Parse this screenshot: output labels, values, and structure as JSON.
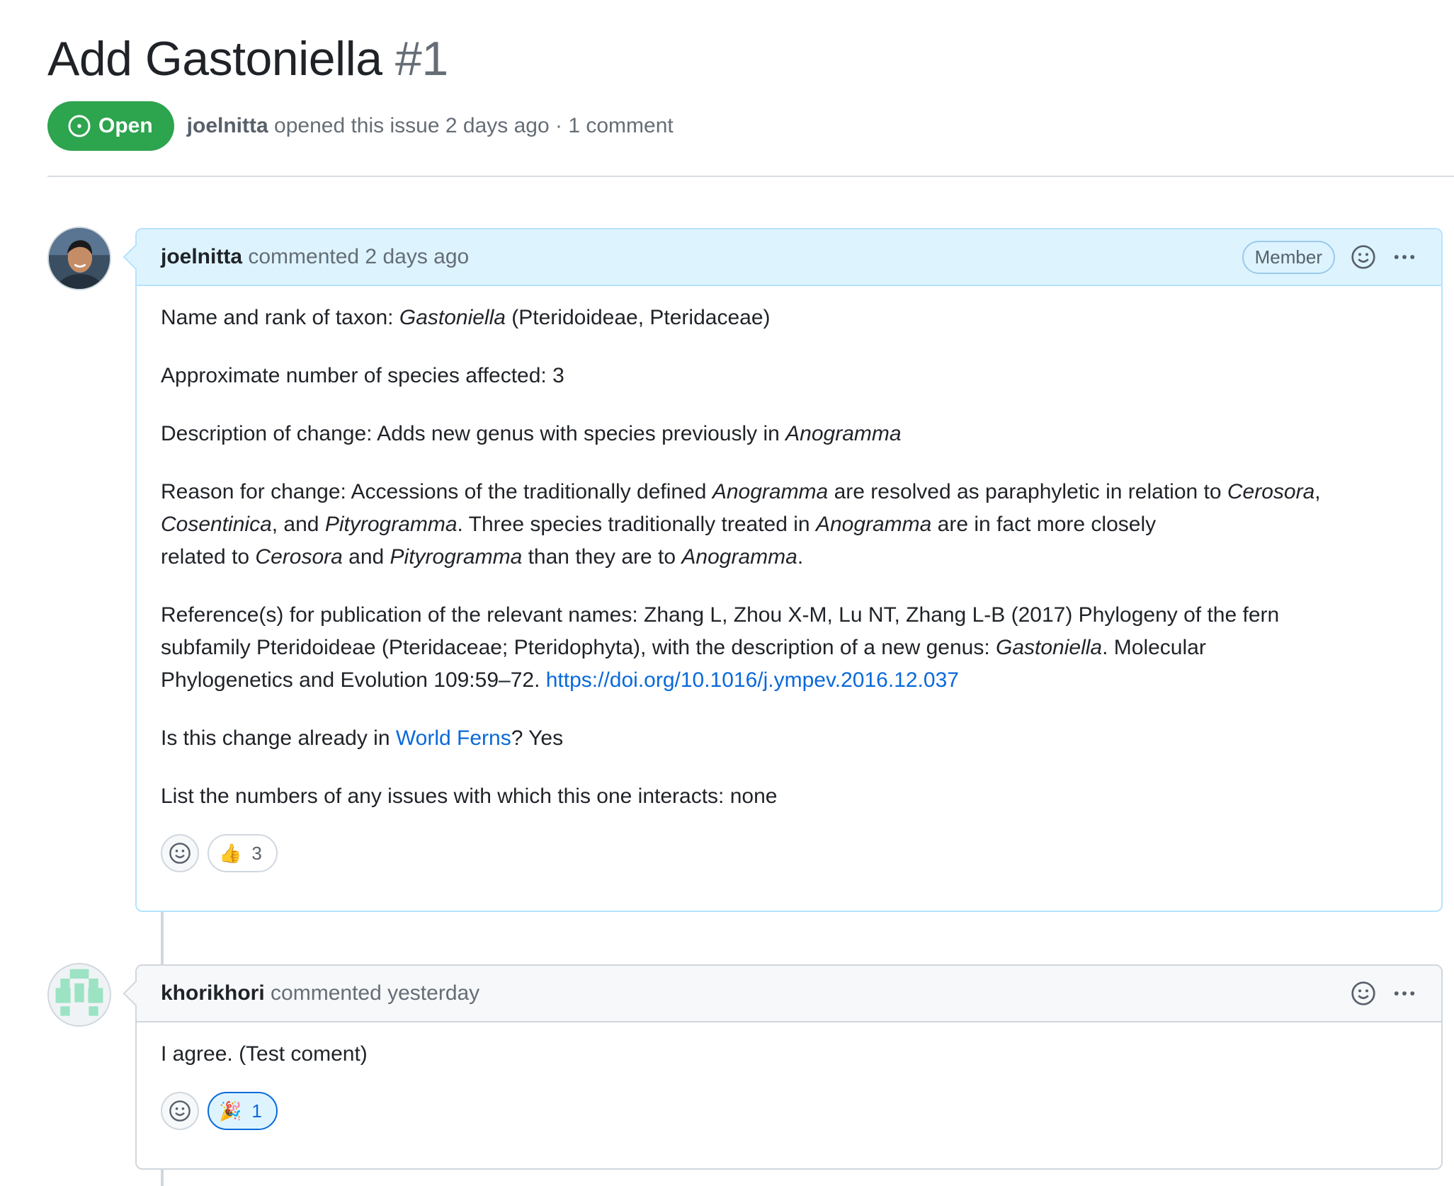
{
  "issue": {
    "title": "Add Gastoniella",
    "number": "#1",
    "state": "Open",
    "author": "joelnitta",
    "opened_text": "opened this issue 2 days ago",
    "separator": "·",
    "comment_count": "1 comment"
  },
  "comments": [
    {
      "author": "joelnitta",
      "action": "commented 2 days ago",
      "role": "Member",
      "body": {
        "p1": [
          "Name and rank of taxon: ",
          "Gastoniella",
          " (Pteridoideae, Pteridaceae)"
        ],
        "p2": "Approximate number of species affected: 3",
        "p3": [
          "Description of change: Adds new genus with species previously in ",
          "Anogramma"
        ],
        "p4": [
          "Reason for change: Accessions of the traditionally defined ",
          "Anogramma",
          " are resolved as paraphyletic in relation to ",
          "Cerosora",
          ",",
          "Cosentinica",
          ", and ",
          "Pityrogramma",
          ". Three species traditionally treated in ",
          "Anogramma",
          " are in fact more closely",
          "related to ",
          "Cerosora",
          " and ",
          "Pityrogramma",
          " than they are to ",
          "Anogramma",
          "."
        ],
        "p5": [
          "Reference(s) for publication of the relevant names: Zhang L, Zhou X-M, Lu NT, Zhang L-B (2017) Phylogeny of the fern",
          "subfamily Pteridoideae (Pteridaceae; Pteridophyta), with the description of a new genus: ",
          "Gastoniella",
          ". Molecular",
          "Phylogenetics and Evolution 109:59–72. ",
          "https://doi.org/10.1016/j.ympev.2016.12.037"
        ],
        "p6": [
          "Is this change already in ",
          "World Ferns",
          "? Yes"
        ],
        "p7": "List the numbers of any issues with which this one interacts: none"
      },
      "reactions": [
        {
          "emoji": "👍",
          "count": "3"
        }
      ]
    },
    {
      "author": "khorikhori",
      "action": "commented yesterday",
      "body": "I agree. (Test coment)",
      "reactions": [
        {
          "emoji": "🎉",
          "count": "1"
        }
      ]
    }
  ],
  "colors": {
    "open_green": "#2da44e",
    "link_blue": "#0969da",
    "member_header": "#ddf4ff"
  },
  "icons": [
    "issue-opened-icon",
    "smiley-icon",
    "kebab-horizontal-icon"
  ]
}
